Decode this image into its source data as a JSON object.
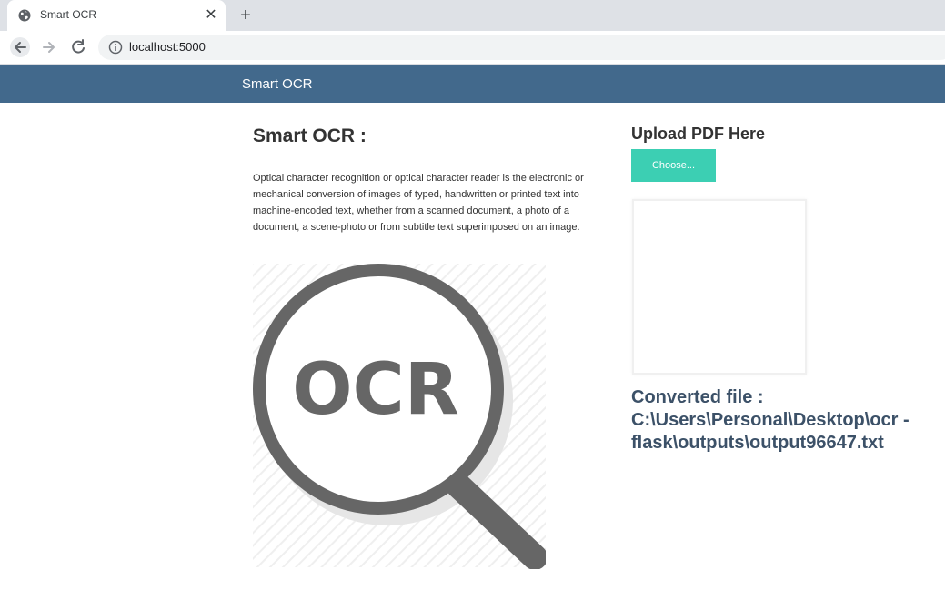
{
  "browser": {
    "tab_title": "Smart OCR",
    "close_glyph": "✕",
    "new_tab_glyph": "+",
    "url": "localhost:5000",
    "icons": [
      "globe-icon",
      "close-icon",
      "plus-icon",
      "back-arrow-icon",
      "forward-arrow-icon",
      "reload-icon",
      "info-icon"
    ]
  },
  "navbar": {
    "brand": "Smart OCR",
    "color": "#42698c"
  },
  "main": {
    "title": "Smart OCR :",
    "description": "Optical character recognition or optical character reader is the electronic or mechanical conversion of images of typed, handwritten or printed text into machine-encoded text, whether from a scanned document, a photo of a document, a scene-photo or from subtitle text superimposed on an image.",
    "image_text": "OCR",
    "image_icon": "magnifier-icon"
  },
  "upload": {
    "title": "Upload PDF Here",
    "button_label": "Choose...",
    "button_color": "#3ccfb3"
  },
  "result": {
    "converted_text": "Converted file : C:\\Users\\Personal\\Desktop\\ocr - flask\\outputs\\output96647.txt"
  }
}
